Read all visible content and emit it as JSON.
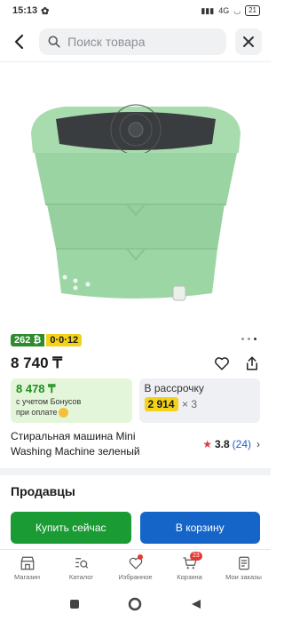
{
  "status_bar": {
    "time": "15:13",
    "signal_text": "4G",
    "battery": "21"
  },
  "search": {
    "placeholder": "Поиск товара"
  },
  "product": {
    "bonus_badge": "262 ₿",
    "installment_badge": "0·0·12",
    "price": "8 740 ₸",
    "bonus_offer": {
      "amount": "8 478 ₸",
      "note_line1": "с учетом Бонусов",
      "note_line2": "при оплате"
    },
    "credit_offer": {
      "title": "В рассрочку",
      "amount": "2 914",
      "times": "× 3"
    },
    "title": "Стиральная машина Mini Washing Machine зеленый",
    "rating": "3.8",
    "reviews": "(24)"
  },
  "sellers_heading": "Продавцы",
  "cta": {
    "buy_now": "Купить сейчас",
    "add_to_cart": "В корзину"
  },
  "tabs": [
    {
      "label": "Магазин"
    },
    {
      "label": "Каталог"
    },
    {
      "label": "Избранное"
    },
    {
      "label": "Корзина",
      "count": "23"
    },
    {
      "label": "Мои заказы"
    }
  ],
  "colors": {
    "green": "#1a9b34",
    "blue": "#1565c8",
    "yellow": "#f2d21b"
  }
}
